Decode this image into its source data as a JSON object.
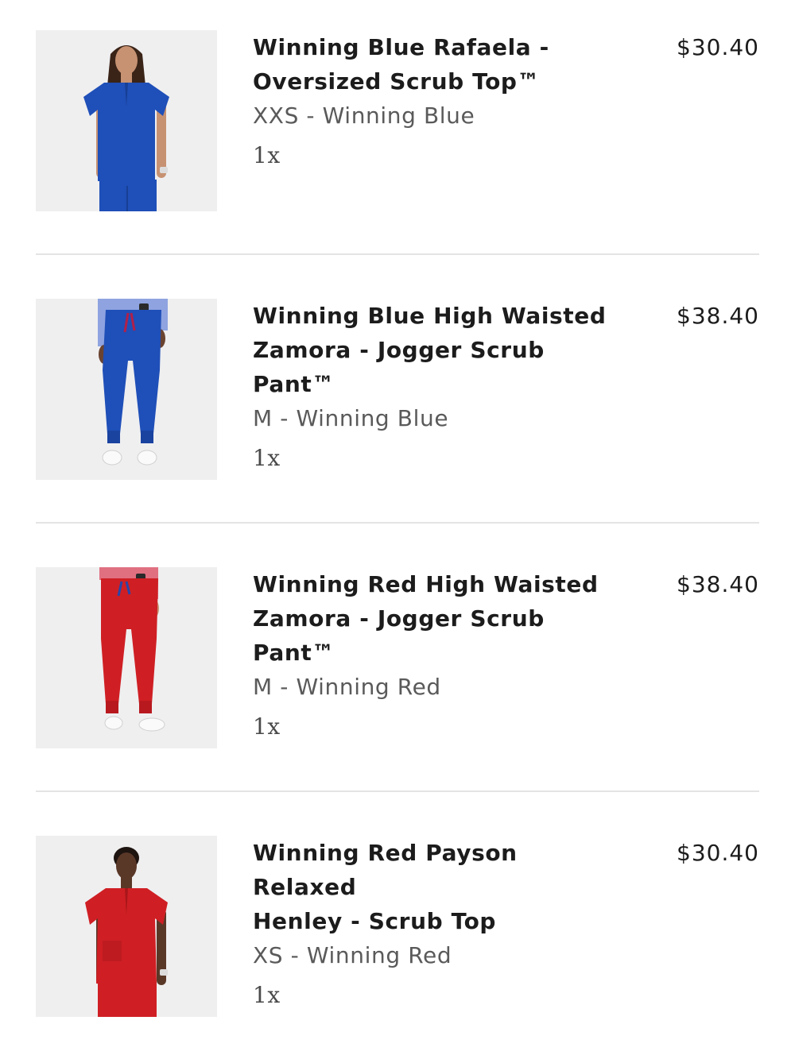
{
  "cart": {
    "items": [
      {
        "title_line1": "Winning Blue Rafaela -",
        "title_line2": "Oversized Scrub Top™",
        "variant": "XXS - Winning Blue",
        "quantity": "1x",
        "price": "$30.40",
        "image_icon": "woman-in-blue-scrub-top-photo",
        "garment_color": "#1f4fb8"
      },
      {
        "title_line1": "Winning Blue High Waisted",
        "title_line2": "Zamora - Jogger Scrub Pant™",
        "variant": "M - Winning Blue",
        "quantity": "1x",
        "price": "$38.40",
        "image_icon": "blue-jogger-pants-photo",
        "garment_color": "#1f4fb8"
      },
      {
        "title_line1": "Winning Red High Waisted",
        "title_line2": "Zamora - Jogger Scrub Pant™",
        "variant": "M - Winning Red",
        "quantity": "1x",
        "price": "$38.40",
        "image_icon": "red-jogger-pants-photo",
        "garment_color": "#cf1f24"
      },
      {
        "title_line1": "Winning Red Payson Relaxed",
        "title_line2": "Henley - Scrub Top",
        "variant": "XS - Winning Red",
        "quantity": "1x",
        "price": "$30.40",
        "image_icon": "woman-in-red-scrub-top-photo",
        "garment_color": "#cf1f24"
      }
    ]
  }
}
